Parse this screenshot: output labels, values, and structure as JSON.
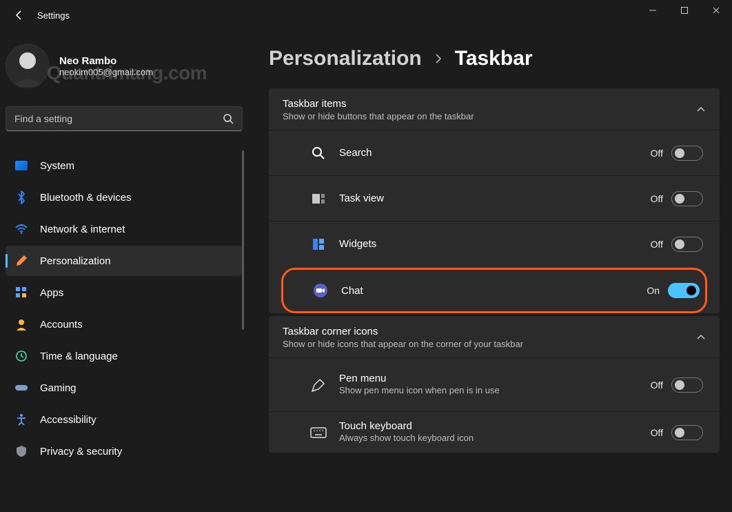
{
  "window": {
    "title": "Settings",
    "controls": {
      "minimize": "−",
      "maximize": "□",
      "close": "✕"
    }
  },
  "profile": {
    "name": "Neo Rambo",
    "email": "neokim005@gmail.com",
    "watermark": "Quantrimang.com"
  },
  "search": {
    "placeholder": "Find a setting"
  },
  "sidebar": {
    "items": [
      {
        "icon": "display-icon",
        "label": "System"
      },
      {
        "icon": "bluetooth-icon",
        "label": "Bluetooth & devices"
      },
      {
        "icon": "wifi-icon",
        "label": "Network & internet"
      },
      {
        "icon": "brush-icon",
        "label": "Personalization",
        "active": true
      },
      {
        "icon": "apps-icon",
        "label": "Apps"
      },
      {
        "icon": "person-icon",
        "label": "Accounts"
      },
      {
        "icon": "clock-icon",
        "label": "Time & language"
      },
      {
        "icon": "gamepad-icon",
        "label": "Gaming"
      },
      {
        "icon": "accessibility-icon",
        "label": "Accessibility"
      },
      {
        "icon": "shield-icon",
        "label": "Privacy & security"
      }
    ]
  },
  "breadcrumb": {
    "parent": "Personalization",
    "current": "Taskbar"
  },
  "sections": [
    {
      "title": "Taskbar items",
      "subtitle": "Show or hide buttons that appear on the taskbar",
      "expanded": true,
      "rows": [
        {
          "icon": "search-icon",
          "label": "Search",
          "state": "Off",
          "on": false
        },
        {
          "icon": "taskview-icon",
          "label": "Task view",
          "state": "Off",
          "on": false
        },
        {
          "icon": "widgets-icon",
          "label": "Widgets",
          "state": "Off",
          "on": false
        },
        {
          "icon": "chat-icon",
          "label": "Chat",
          "state": "On",
          "on": true,
          "highlighted": true
        }
      ]
    },
    {
      "title": "Taskbar corner icons",
      "subtitle": "Show or hide icons that appear on the corner of your taskbar",
      "expanded": true,
      "rows": [
        {
          "icon": "pen-icon",
          "label": "Pen menu",
          "sub": "Show pen menu icon when pen is in use",
          "state": "Off",
          "on": false
        },
        {
          "icon": "keyboard-icon",
          "label": "Touch keyboard",
          "sub": "Always show touch keyboard icon",
          "state": "Off",
          "on": false
        }
      ]
    }
  ]
}
